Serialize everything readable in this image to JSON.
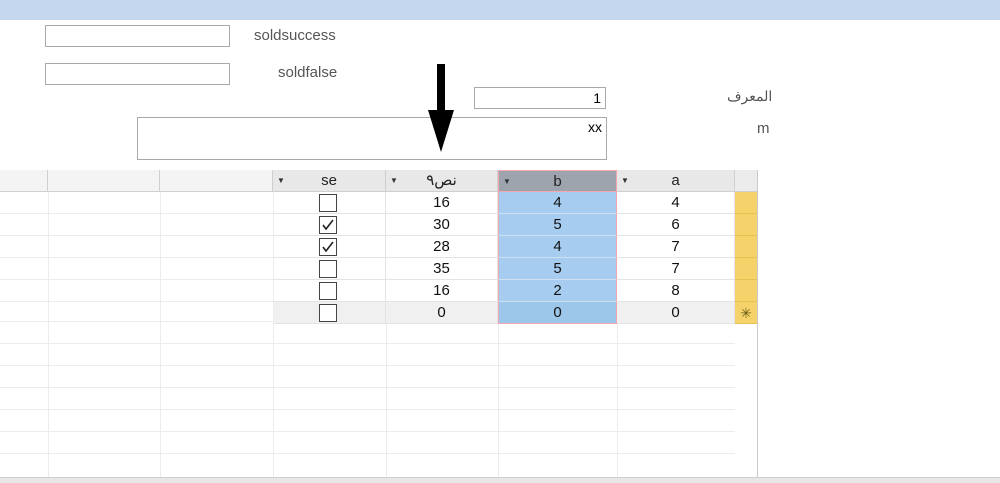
{
  "form": {
    "soldsuccess_label": "soldsuccess",
    "soldfalse_label": "soldfalse",
    "id_label": "المعرف",
    "id_value": "1",
    "m_label": "m",
    "m_value": "xx"
  },
  "grid": {
    "columns": [
      "se",
      "نص٩",
      "b",
      "a"
    ],
    "rows": [
      {
        "se": false,
        "nass": "16",
        "b": "4",
        "a": "4"
      },
      {
        "se": true,
        "nass": "30",
        "b": "5",
        "a": "6"
      },
      {
        "se": true,
        "nass": "28",
        "b": "4",
        "a": "7"
      },
      {
        "se": false,
        "nass": "35",
        "b": "5",
        "a": "7"
      },
      {
        "se": false,
        "nass": "16",
        "b": "2",
        "a": "8"
      }
    ],
    "new_row": {
      "nass": "0",
      "b": "0",
      "a": "0"
    },
    "new_row_marker": "✳"
  },
  "colors": {
    "topbar": "#c5d7ef",
    "row_selector": "#f5d36a",
    "selected_column": "#a6cdef"
  }
}
